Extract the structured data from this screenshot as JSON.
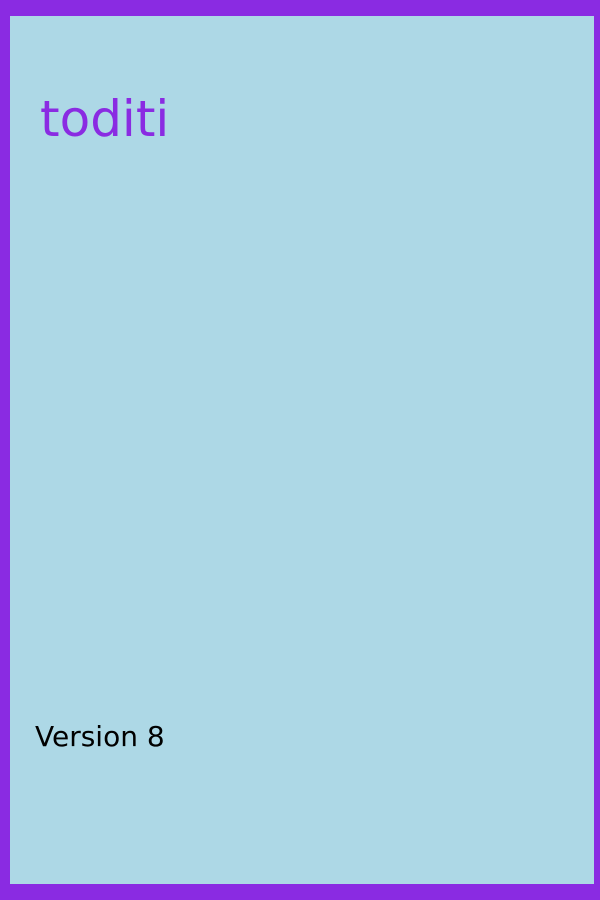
{
  "app": {
    "title": "toditi",
    "version_label": "Version 8"
  },
  "colors": {
    "border": "#8a2be2",
    "background": "#add8e6",
    "title": "#8a2be2",
    "version_text": "#000000"
  }
}
